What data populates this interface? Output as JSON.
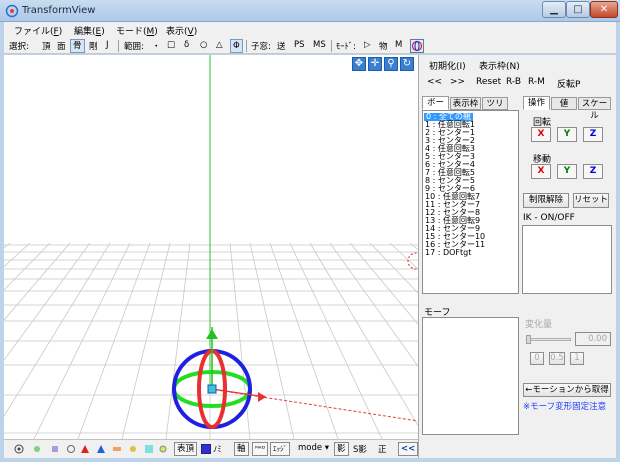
{
  "window": {
    "title": "TransformView"
  },
  "menu": [
    {
      "label": "ファイル(",
      "key": "F",
      "suffix": ")"
    },
    {
      "label": "編集(",
      "key": "E",
      "suffix": ")"
    },
    {
      "label": "モード(",
      "key": "M",
      "suffix": ")"
    },
    {
      "label": "表示(",
      "key": "V",
      "suffix": ")"
    }
  ],
  "toolbar": {
    "select_label": "選択:",
    "select_items": [
      "頂",
      "面",
      "骨",
      "剛",
      "J"
    ],
    "range_label": "範囲:",
    "range_items": [
      "・",
      "□",
      "δ",
      "○",
      "△",
      "Φ"
    ],
    "child_label": "子窓:",
    "child_items": [
      "送",
      "PS",
      "MS"
    ],
    "mode_label": "ﾓｰﾄﾞ:",
    "mode_items": [
      "▷",
      "物",
      "M"
    ]
  },
  "status": {
    "hyocho": "表頂",
    "normal": "ﾉﾐ",
    "axis": "軸",
    "mode": "mode",
    "shadow": "影",
    "sshadow": "S影",
    "ortho": "正",
    "collapse": "<<"
  },
  "panel": {
    "init_menu": "初期化(I)",
    "display_frame": "表示枠(N)",
    "nav": [
      "<<",
      ">>",
      "Reset",
      "R-B",
      "R-M",
      "反転P"
    ],
    "bone_tabs": [
      "ボーン",
      "表示枠",
      "ツリー"
    ],
    "op_tabs": [
      "操作",
      "値",
      "スケール"
    ],
    "bones": [
      "0 : 全ての親",
      "1 : 任意回転1",
      "2 : センター1",
      "3 : センター2",
      "4 : 任意回転3",
      "5 : センター3",
      "6 : センター4",
      "7 : 任意回転5",
      "8 : センター5",
      "9 : センター6",
      "10 : 任意回転7",
      "11 : センター7",
      "12 : センター8",
      "13 : 任意回転9",
      "14 : センター9",
      "15 : センター10",
      "16 : センター11",
      "17 : DOFtgt"
    ],
    "rotate_label": "回転",
    "move_label": "移動",
    "axes": [
      "X",
      "Y",
      "Z"
    ],
    "axis_colors": {
      "X": "#e00000",
      "Y": "#008000",
      "Z": "#0000e0"
    },
    "limit_release": "制限解除",
    "reset": "リセット",
    "ik_label": "IK - ON/OFF",
    "morph_label": "モーフ",
    "change_amount": "変化量",
    "slider_value": "0.00",
    "slider_buttons": [
      "0",
      "0.5",
      "1"
    ],
    "get_from_motion": "←モーションから取得",
    "morph_note": "※モーフ変形固定注意"
  },
  "colors": {
    "x_axis": "#e02020",
    "y_axis": "#10b010",
    "z_axis": "#2020e0",
    "selection": "#3399ff"
  }
}
